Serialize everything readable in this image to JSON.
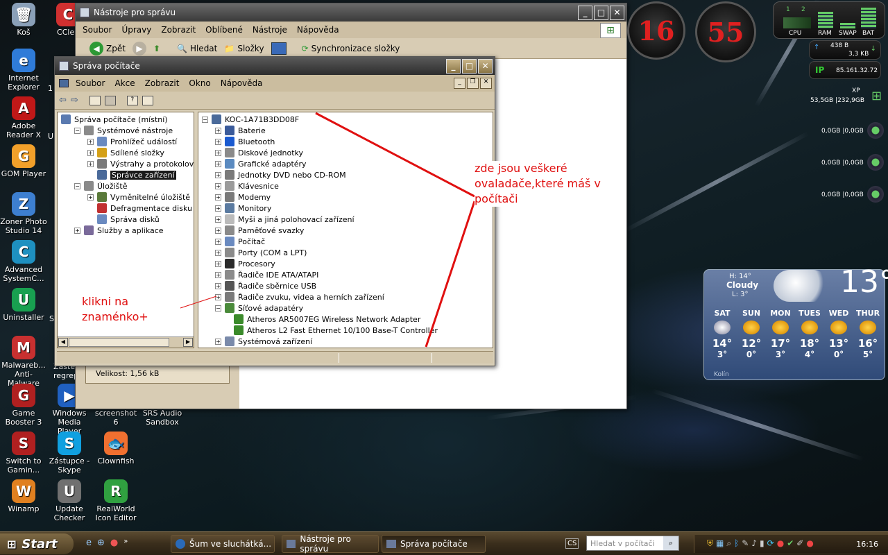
{
  "desktop_icons": [
    {
      "label": "Koš",
      "color": "#8aa0b8",
      "glyph": "🗑"
    },
    {
      "label": "Internet Explorer",
      "color": "#2f7bd8",
      "glyph": "e"
    },
    {
      "label": "Adobe Reader X",
      "color": "#c01818",
      "glyph": "A"
    },
    {
      "label": "GOM Player",
      "color": "#f2a02a",
      "glyph": "G"
    },
    {
      "label": "Zoner Photo Studio 14",
      "color": "#3d7fd0",
      "glyph": "Z"
    },
    {
      "label": "Advanced SystemC...",
      "color": "#1e90c0",
      "glyph": "C"
    },
    {
      "label": "Uninstaller",
      "color": "#18a050",
      "glyph": "U"
    },
    {
      "label": "Malwareb... Anti-Malware",
      "color": "#c83030",
      "glyph": "M"
    },
    {
      "label": "Game Booster 3",
      "color": "#b02020",
      "glyph": "G"
    },
    {
      "label": "Switch to Gamin...",
      "color": "#b02020",
      "glyph": "S"
    },
    {
      "label": "Winamp",
      "color": "#e08020",
      "glyph": "W"
    },
    {
      "label": "CClea",
      "color": "#d03030",
      "glyph": "C"
    },
    {
      "label": "Windows Media Player",
      "color": "#2060c0",
      "glyph": "▶"
    },
    {
      "label": "Zástupce - Skype",
      "color": "#10a0e0",
      "glyph": "S"
    },
    {
      "label": "Update Checker",
      "color": "#707070",
      "glyph": "U"
    },
    {
      "label": "screenshot 6",
      "color": "#606060",
      "glyph": ""
    },
    {
      "label": "Clownfish",
      "color": "#f07030",
      "glyph": "🐟"
    },
    {
      "label": "RealWorld Icon Editor",
      "color": "#30a040",
      "glyph": "R"
    },
    {
      "label": "SRS Audio Sandbox",
      "color": "#404040",
      "glyph": ""
    }
  ],
  "partial_labels": {
    "label_1": "1",
    "label_u": "U",
    "label_s": "S",
    "label_regrep": "regrep",
    "label_zaste": "Zaste"
  },
  "back_window": {
    "title": "Nástroje pro správu",
    "menu": [
      "Soubor",
      "Úpravy",
      "Zobrazit",
      "Oblíbené",
      "Nástroje",
      "Nápověda"
    ],
    "toolbar": {
      "back": "Zpět",
      "search": "Hledat",
      "folders": "Složky",
      "sync": "Synchronizace složky"
    },
    "size_text": "Velikost: 1,56 kB"
  },
  "front_window": {
    "title": "Správa počítače",
    "menu": [
      "Soubor",
      "Akce",
      "Zobrazit",
      "Okno",
      "Nápověda"
    ],
    "left_tree": [
      {
        "label": "Správa počítače (místní)",
        "level": 0,
        "expander": ""
      },
      {
        "label": "Systémové nástroje",
        "level": 1,
        "expander": "−"
      },
      {
        "label": "Prohlížeč událostí",
        "level": 2,
        "expander": "+"
      },
      {
        "label": "Sdílené složky",
        "level": 2,
        "expander": "+"
      },
      {
        "label": "Výstrahy a protokolování vý",
        "level": 2,
        "expander": "+"
      },
      {
        "label": "Správce zařízení",
        "level": 2,
        "expander": "",
        "selected": true
      },
      {
        "label": "Úložiště",
        "level": 1,
        "expander": "−"
      },
      {
        "label": "Vyměnitelné úložiště",
        "level": 2,
        "expander": "+"
      },
      {
        "label": "Defragmentace disku",
        "level": 2,
        "expander": ""
      },
      {
        "label": "Správa disků",
        "level": 2,
        "expander": ""
      },
      {
        "label": "Služby a aplikace",
        "level": 1,
        "expander": "+"
      }
    ],
    "right_tree_root": "KOC-1A71B3DD08F",
    "right_tree": [
      {
        "label": "Baterie",
        "expander": "+",
        "level": 1
      },
      {
        "label": "Bluetooth",
        "expander": "+",
        "level": 1
      },
      {
        "label": "Diskové jednotky",
        "expander": "+",
        "level": 1
      },
      {
        "label": "Grafické adaptéry",
        "expander": "+",
        "level": 1
      },
      {
        "label": "Jednotky DVD nebo CD-ROM",
        "expander": "+",
        "level": 1
      },
      {
        "label": "Klávesnice",
        "expander": "+",
        "level": 1
      },
      {
        "label": "Modemy",
        "expander": "+",
        "level": 1
      },
      {
        "label": "Monitory",
        "expander": "+",
        "level": 1
      },
      {
        "label": "Myši a jiná polohovací zařízení",
        "expander": "+",
        "level": 1
      },
      {
        "label": "Paměťové svazky",
        "expander": "+",
        "level": 1
      },
      {
        "label": "Počítač",
        "expander": "+",
        "level": 1
      },
      {
        "label": "Porty (COM a LPT)",
        "expander": "+",
        "level": 1
      },
      {
        "label": "Procesory",
        "expander": "+",
        "level": 1
      },
      {
        "label": "Řadiče IDE ATA/ATAPI",
        "expander": "+",
        "level": 1
      },
      {
        "label": "Řadiče sběrnice USB",
        "expander": "+",
        "level": 1
      },
      {
        "label": "Řadiče zvuku, videa a herních zařízení",
        "expander": "+",
        "level": 1
      },
      {
        "label": "Síťové adapatéry",
        "expander": "−",
        "level": 1
      },
      {
        "label": "Atheros AR5007EG Wireless Network Adapter",
        "expander": "",
        "level": 2
      },
      {
        "label": "Atheros L2 Fast Ethernet 10/100 Base-T Controller",
        "expander": "",
        "level": 2
      },
      {
        "label": "Systémová zařízení",
        "expander": "+",
        "level": 1
      }
    ]
  },
  "annotations": {
    "drivers_note": "zde jsou veškeré ovaladače,které máš v počítači",
    "click_note": "klikni na znaménko+"
  },
  "gadgets": {
    "clock_hours": "16",
    "clock_minutes": "55",
    "meters": {
      "cpu": "CPU",
      "ram": "RAM",
      "swap": "SWAP",
      "bat": "BAT",
      "n1": "1",
      "n2": "2"
    },
    "net_up": "438 B",
    "net_down": "3,3 KB",
    "ip_label": "IP",
    "ip": "85.161.32.72",
    "os": "XP",
    "disk_main": "53,5GB |232,9GB",
    "drives": [
      "0,0GB |0,0GB",
      "0,0GB |0,0GB",
      "0,0GB |0,0GB"
    ]
  },
  "weather": {
    "high": "H: 14°",
    "condition": "Cloudy",
    "low": "L: 3°",
    "temp": "13°",
    "location": "Kolín",
    "days": [
      {
        "day": "SAT",
        "hi": "14°",
        "lo": "3°"
      },
      {
        "day": "SUN",
        "hi": "12°",
        "lo": "0°"
      },
      {
        "day": "MON",
        "hi": "17°",
        "lo": "3°"
      },
      {
        "day": "TUES",
        "hi": "18°",
        "lo": "4°"
      },
      {
        "day": "WED",
        "hi": "13°",
        "lo": "0°"
      },
      {
        "day": "THUR",
        "hi": "16°",
        "lo": "5°"
      }
    ]
  },
  "taskbar": {
    "start": "Start",
    "tasks": [
      "Šum ve sluchátká...",
      "Nástroje pro správu",
      "Správa počítače"
    ],
    "lang": "CS",
    "search_placeholder": "Hledat v počítači",
    "time": "16:16"
  }
}
